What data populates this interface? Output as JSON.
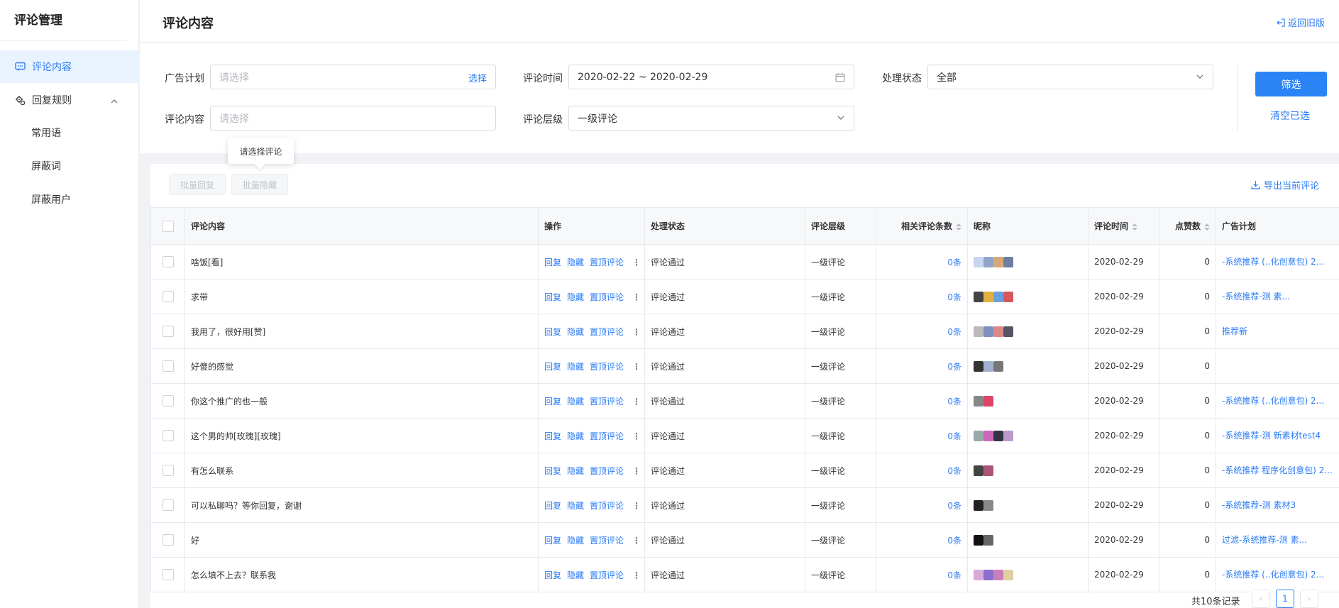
{
  "sidebar": {
    "title": "评论管理",
    "items": [
      {
        "label": "评论内容",
        "icon": "comment-icon",
        "active": true
      },
      {
        "label": "回复规则",
        "icon": "gear-icon",
        "expanded": true,
        "children": [
          {
            "label": "常用语"
          },
          {
            "label": "屏蔽词"
          },
          {
            "label": "屏蔽用户"
          }
        ]
      }
    ]
  },
  "header": {
    "title": "评论内容",
    "back_label": "返回旧版"
  },
  "filter": {
    "ad_plan": {
      "label": "广告计划",
      "placeholder": "请选择",
      "action": "选择"
    },
    "comment_time": {
      "label": "评论时间",
      "value": "2020-02-22 ~ 2020-02-29"
    },
    "status": {
      "label": "处理状态",
      "value": "全部"
    },
    "content": {
      "label": "评论内容",
      "placeholder": "请选择"
    },
    "level": {
      "label": "评论层级",
      "value": "一级评论"
    },
    "submit_label": "筛选",
    "clear_label": "清空已选"
  },
  "toolbar": {
    "batch_reply": "批量回复",
    "batch_hide": "批量隐藏",
    "tooltip": "请选择评论",
    "export_label": "导出当前评论"
  },
  "table": {
    "columns": [
      "评论内容",
      "操作",
      "处理状态",
      "评论层级",
      "相关评论条数",
      "昵称",
      "评论时间",
      "点赞数",
      "广告计划"
    ],
    "actions": [
      "回复",
      "隐藏",
      "置顶评论"
    ],
    "rows": [
      {
        "content": "啥饭[看]",
        "status": "评论通过",
        "level": "一级评论",
        "related": "0条",
        "time": "2020-02-29",
        "likes": "0",
        "plan": "-系统推荐 (..化创意包) 2..."
      },
      {
        "content": "求带",
        "status": "评论通过",
        "level": "一级评论",
        "related": "0条",
        "time": "2020-02-29",
        "likes": "0",
        "plan": "-系统推荐-测 素..."
      },
      {
        "content": "我用了，很好用[赞]",
        "status": "评论通过",
        "level": "一级评论",
        "related": "0条",
        "time": "2020-02-29",
        "likes": "0",
        "plan": "推荐新"
      },
      {
        "content": "好傻的感觉",
        "status": "评论通过",
        "level": "一级评论",
        "related": "0条",
        "time": "2020-02-29",
        "likes": "0",
        "plan": ""
      },
      {
        "content": "你这个推广的也一般",
        "status": "评论通过",
        "level": "一级评论",
        "related": "0条",
        "time": "2020-02-29",
        "likes": "0",
        "plan": "-系统推荐 (..化创意包) 2..."
      },
      {
        "content": "这个男的帅[玫瑰][玫瑰]",
        "status": "评论通过",
        "level": "一级评论",
        "related": "0条",
        "time": "2020-02-29",
        "likes": "0",
        "plan": "-系统推荐-测 新素材test4"
      },
      {
        "content": "有怎么联系",
        "status": "评论通过",
        "level": "一级评论",
        "related": "0条",
        "time": "2020-02-29",
        "likes": "0",
        "plan": "-系统推荐 程序化创意包) 2..."
      },
      {
        "content": "可以私聊吗？等你回复，谢谢",
        "status": "评论通过",
        "level": "一级评论",
        "related": "0条",
        "time": "2020-02-29",
        "likes": "0",
        "plan": "-系统推荐-测 素材3"
      },
      {
        "content": "好",
        "status": "评论通过",
        "level": "一级评论",
        "related": "0条",
        "time": "2020-02-29",
        "likes": "0",
        "plan": "过滤-系统推荐-测 素..."
      },
      {
        "content": "怎么填不上去？联系我",
        "status": "评论通过",
        "level": "一级评论",
        "related": "0条",
        "time": "2020-02-29",
        "likes": "0",
        "plan": "-系统推荐 (..化创意包) 2..."
      }
    ]
  },
  "pagination": {
    "total_label": "共10条记录",
    "current_page": "1"
  },
  "colors": {
    "accent": "#2b84f5",
    "active_bg": "#e9f3ff"
  }
}
